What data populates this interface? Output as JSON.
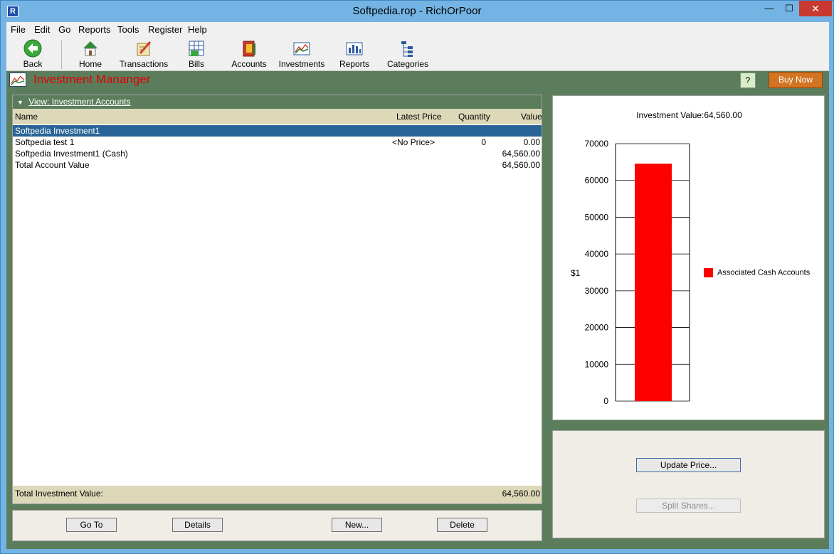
{
  "window": {
    "title": "Softpedia.rop - RichOrPoor",
    "app_icon": "R",
    "min": "—",
    "max": "☐",
    "close": "✕"
  },
  "menu": [
    "File",
    "Edit",
    "Go",
    "Reports",
    "Tools",
    "Register",
    "Help"
  ],
  "toolbar": {
    "back": "Back",
    "home": "Home",
    "transactions": "Transactions",
    "bills": "Bills",
    "accounts": "Accounts",
    "investments": "Investments",
    "reports": "Reports",
    "categories": "Categories"
  },
  "header": {
    "title": "Investment Mananger",
    "help": "?",
    "buy": "Buy Now"
  },
  "view": {
    "label": "View: Investment Accounts"
  },
  "table": {
    "columns": {
      "name": "Name",
      "price": "Latest Price",
      "quantity": "Quantity",
      "value": "Value"
    },
    "rows": [
      {
        "name": "Softpedia Investment1",
        "price": "",
        "quantity": "",
        "value": ""
      },
      {
        "name": "Softpedia test 1",
        "price": "<No Price>",
        "quantity": "0",
        "value": "0.00"
      },
      {
        "name": "Softpedia Investment1 (Cash)",
        "price": "",
        "quantity": "",
        "value": "64,560.00"
      },
      {
        "name": "Total Account Value",
        "price": "",
        "quantity": "",
        "value": "64,560.00"
      }
    ],
    "footer_label": "Total Investment Value:",
    "footer_value": "64,560.00"
  },
  "buttons": {
    "goto": "Go To",
    "details": "Details",
    "new": "New...",
    "delete": "Delete",
    "update_price": "Update Price...",
    "split_shares": "Split Shares..."
  },
  "chart_data": {
    "type": "bar",
    "title": "Investment Value:64,560.00",
    "ylabel": "$1",
    "ylim": [
      0,
      70000
    ],
    "yticks": [
      "0",
      "10000",
      "20000",
      "30000",
      "40000",
      "50000",
      "60000",
      "70000"
    ],
    "series": [
      {
        "name": "Associated Cash Accounts",
        "values": [
          64560
        ],
        "color": "#ff0000"
      }
    ]
  },
  "colors": {
    "accent": "#5c7d5c",
    "selection": "#2a6496",
    "buy": "#d27422",
    "title_text": "#e00000"
  }
}
